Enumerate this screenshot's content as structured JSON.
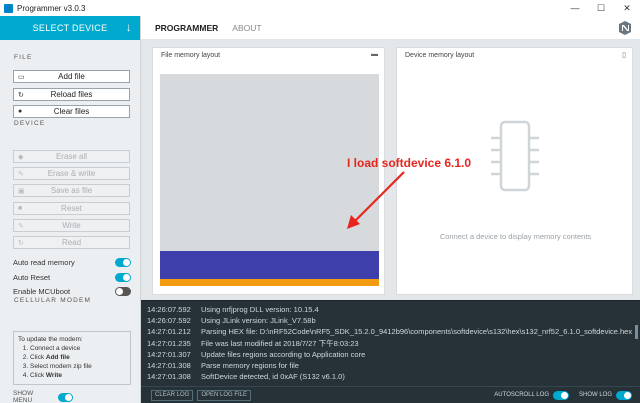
{
  "window": {
    "title": "Programmer v3.0.3",
    "controls": [
      "—",
      "☐",
      "✕"
    ]
  },
  "sidebar": {
    "select_device": "SELECT DEVICE",
    "file_section": "FILE",
    "file_buttons": [
      {
        "label": "Add file",
        "icon": "folder-open-icon"
      },
      {
        "label": "Reload files",
        "icon": "refresh-icon"
      },
      {
        "label": "Clear files",
        "icon": "clear-icon"
      }
    ],
    "device_section": "DEVICE",
    "device_buttons": [
      {
        "label": "Erase all",
        "icon": "eraser-icon"
      },
      {
        "label": "Erase & write",
        "icon": "pencil-icon"
      },
      {
        "label": "Save as file",
        "icon": "save-icon"
      },
      {
        "label": "Reset",
        "icon": "stop-icon"
      },
      {
        "label": "Write",
        "icon": "pencil-icon"
      },
      {
        "label": "Read",
        "icon": "refresh-icon"
      }
    ],
    "toggles": [
      {
        "label": "Auto read memory",
        "on": true
      },
      {
        "label": "Auto Reset",
        "on": true
      },
      {
        "label": "Enable MCUboot",
        "on": false
      }
    ],
    "modem_section": "CELLULAR MODEM",
    "modem_intro": "To update the modem:",
    "modem_steps": [
      {
        "pre": "Connect a device",
        "bold": ""
      },
      {
        "pre": "Click ",
        "bold": "Add file"
      },
      {
        "pre": "Select modem zip file",
        "bold": ""
      },
      {
        "pre": "Click ",
        "bold": "Write"
      }
    ],
    "show_menu": "SHOW MENU"
  },
  "nav": {
    "tabs": [
      "PROGRAMMER",
      "ABOUT"
    ]
  },
  "file_panel": {
    "title": "File memory layout"
  },
  "device_panel": {
    "title": "Device memory layout",
    "hint": "Connect a device to display memory contents"
  },
  "annotation": "I load softdevice 6.1.0",
  "colors": {
    "accent": "#00a9ce",
    "softdevice": "#3e3faa",
    "app": "#f39c12",
    "annotation": "#e8241f"
  },
  "log": [
    {
      "ts": "14:26:07.592",
      "msg": "Using nrfjprog DLL version: 10.15.4"
    },
    {
      "ts": "14:26:07.592",
      "msg": "Using JLink version: JLink_V7.58b"
    },
    {
      "ts": "14:27:01.212",
      "msg": "Parsing HEX file: D:\\nRF52Code\\nRF5_SDK_15.2.0_9412b96\\components\\softdevice\\s132\\hex\\s132_nrf52_6.1.0_softdevice.hex"
    },
    {
      "ts": "14:27:01.235",
      "msg": "File was last modified at 2018/7/27 下午8:03:23"
    },
    {
      "ts": "14:27:01.307",
      "msg": "Update files regions according to Application core"
    },
    {
      "ts": "14:27:01.308",
      "msg": "Parse memory regions for file"
    },
    {
      "ts": "14:27:01.308",
      "msg": "SoftDevice detected, id 0xAF (S132 v6.1.0)"
    }
  ],
  "footer": {
    "clear_log": "CLEAR LOG",
    "open_log_file": "OPEN LOG FILE",
    "autoscroll": "AUTOSCROLL LOG",
    "show_log": "SHOW LOG"
  }
}
